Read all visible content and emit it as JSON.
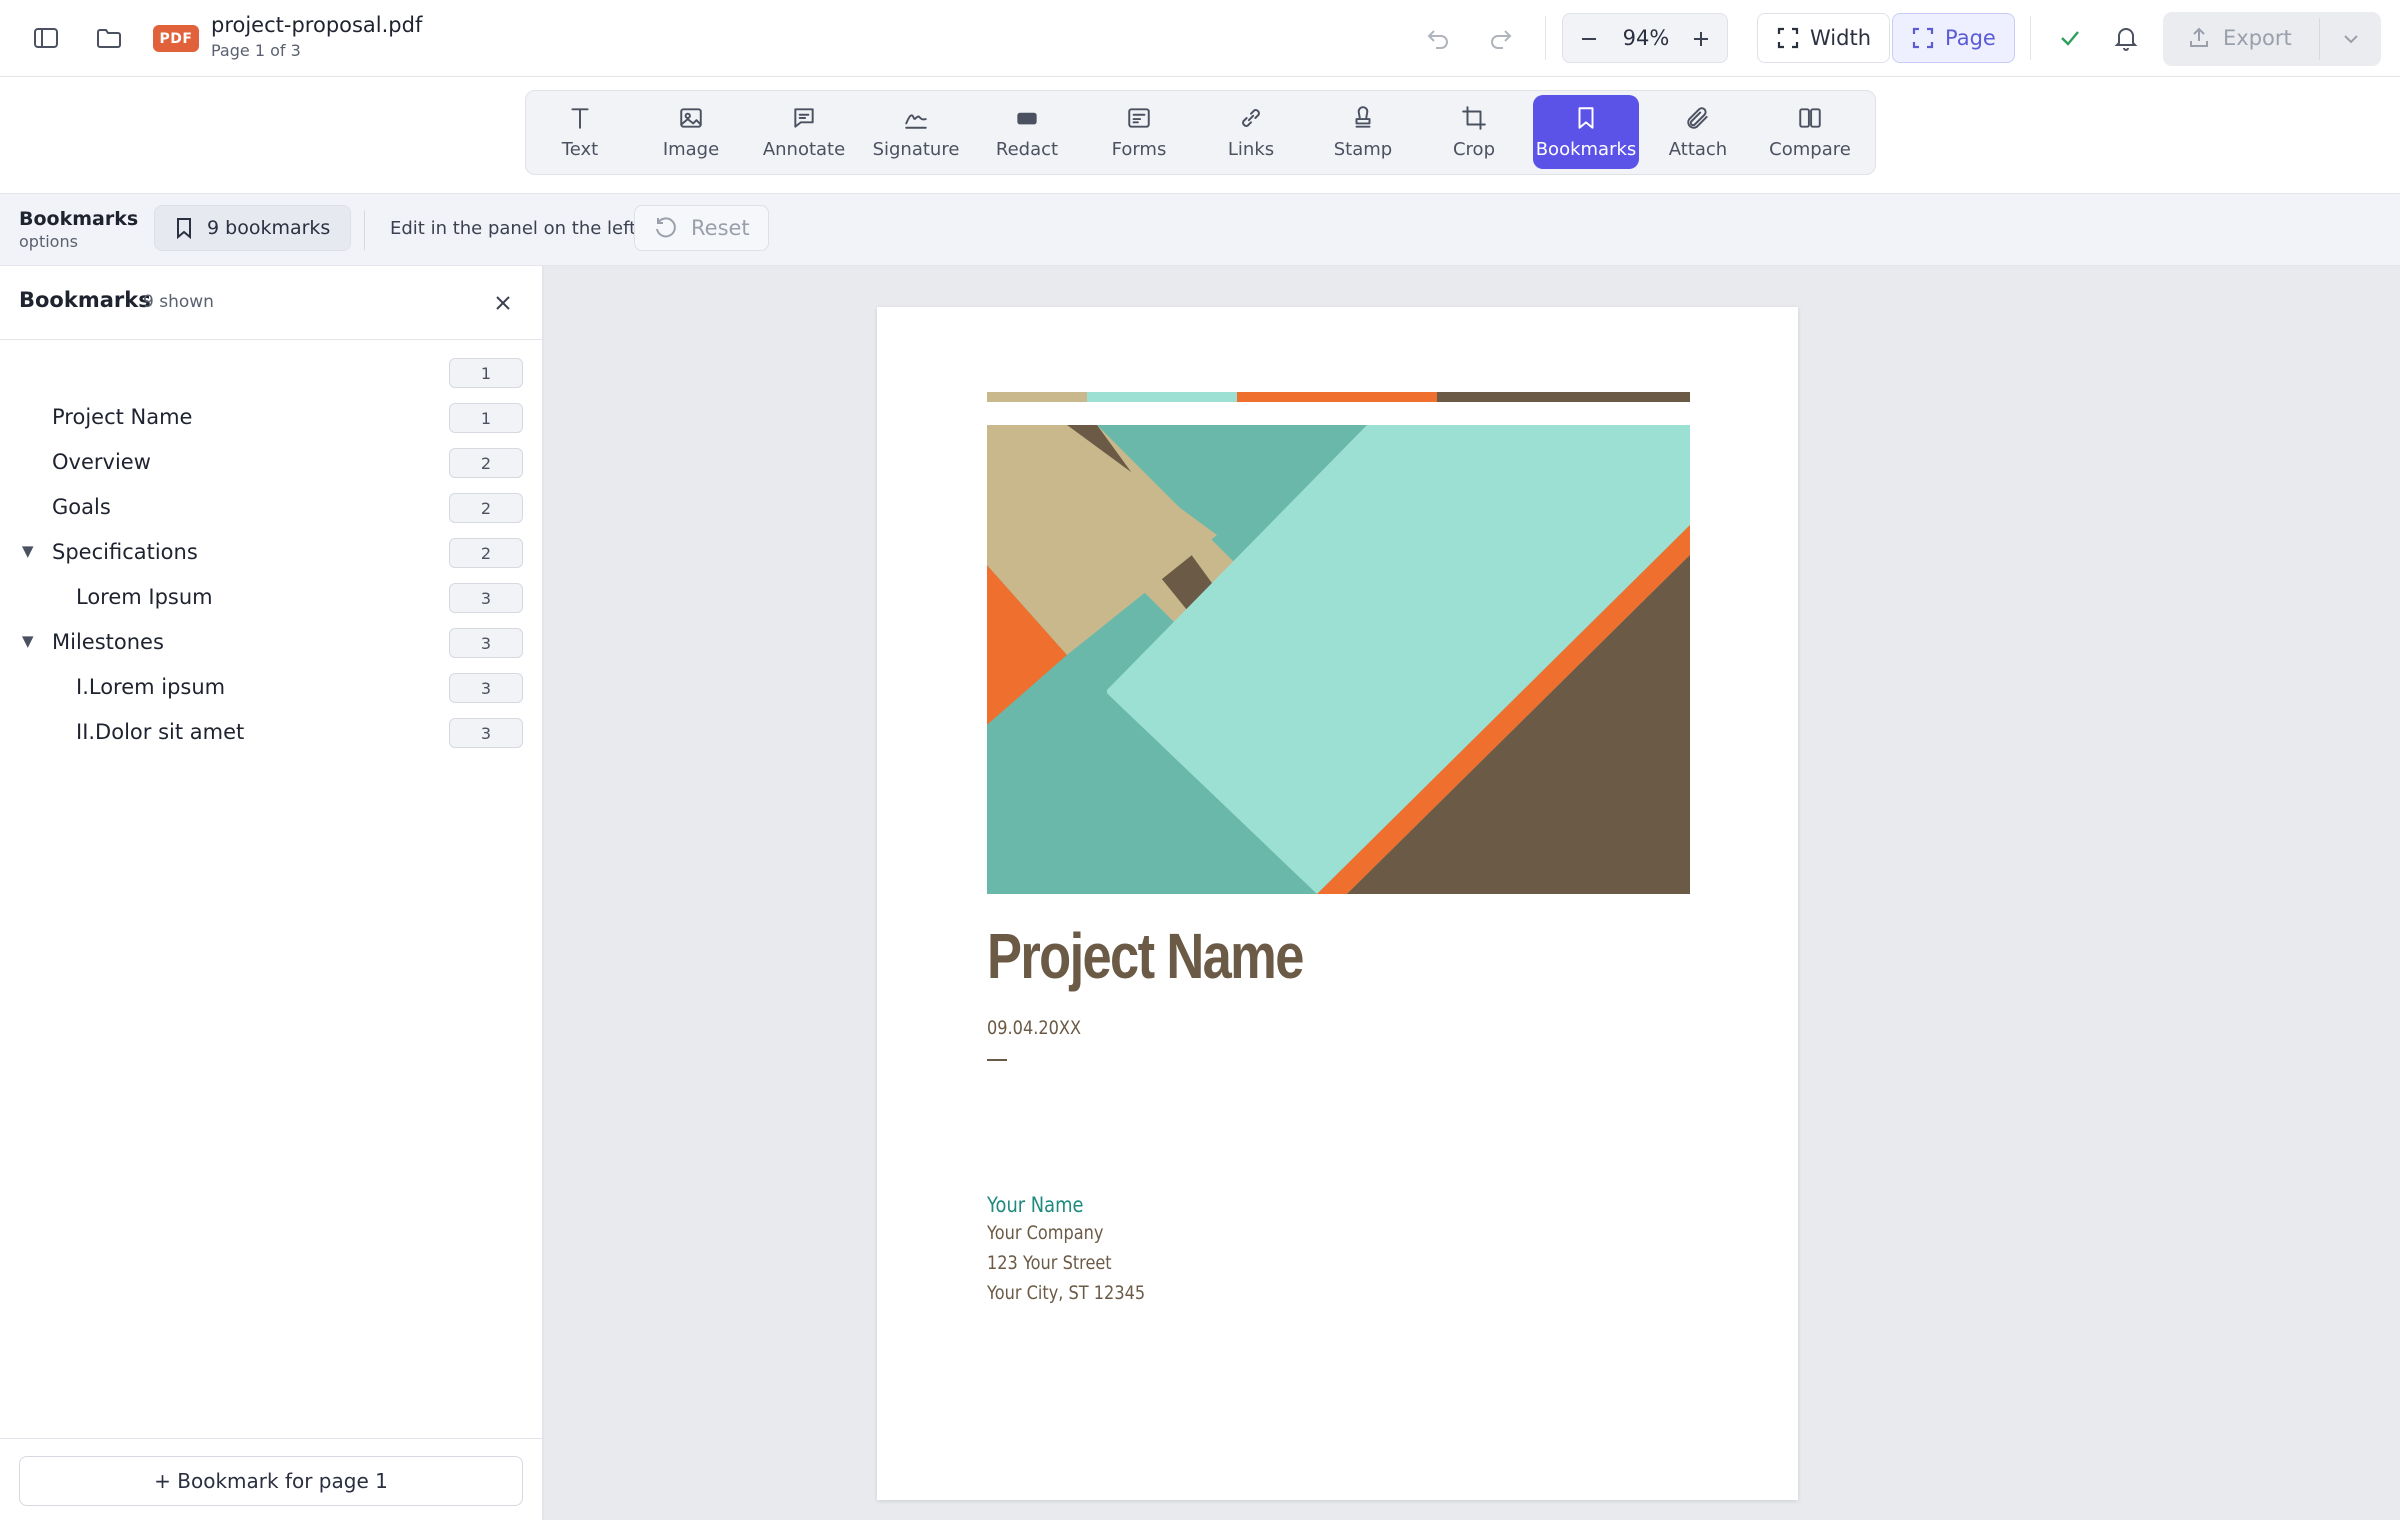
{
  "header": {
    "file_badge": "PDF",
    "file_name": "project-proposal.pdf",
    "page_info": "Page 1 of 3",
    "zoom": "94%",
    "fit_width_label": "Width",
    "fit_page_label": "Page",
    "export_label": "Export"
  },
  "toolbar": {
    "active": "Bookmarks",
    "tools": [
      {
        "label": "Text",
        "icon": "text-icon"
      },
      {
        "label": "Image",
        "icon": "image-icon"
      },
      {
        "label": "Annotate",
        "icon": "annotate-icon"
      },
      {
        "label": "Signature",
        "icon": "signature-icon"
      },
      {
        "label": "Redact",
        "icon": "redact-icon"
      },
      {
        "label": "Forms",
        "icon": "forms-icon"
      },
      {
        "label": "Links",
        "icon": "link-icon"
      },
      {
        "label": "Stamp",
        "icon": "stamp-icon"
      },
      {
        "label": "Crop",
        "icon": "crop-icon"
      },
      {
        "label": "Bookmarks",
        "icon": "bookmark-icon"
      },
      {
        "label": "Attach",
        "icon": "paperclip-icon"
      },
      {
        "label": "Compare",
        "icon": "compare-icon"
      }
    ]
  },
  "options": {
    "title": "Bookmarks",
    "subtitle": "options",
    "count_label": "9 bookmarks",
    "hint": "Edit in the panel on the left",
    "reset_label": "Reset"
  },
  "sidebar": {
    "title": "Bookmarks",
    "count": "9 shown",
    "bookmarks": [
      {
        "label": "",
        "page": "1",
        "level": 0,
        "expandable": false
      },
      {
        "label": "Project Name",
        "page": "1",
        "level": 0,
        "expandable": false
      },
      {
        "label": "Overview",
        "page": "2",
        "level": 0,
        "expandable": false
      },
      {
        "label": "Goals",
        "page": "2",
        "level": 0,
        "expandable": false
      },
      {
        "label": "Specifications",
        "page": "2",
        "level": 0,
        "expandable": true
      },
      {
        "label": "Lorem Ipsum",
        "page": "3",
        "level": 1,
        "expandable": false
      },
      {
        "label": "Milestones",
        "page": "3",
        "level": 0,
        "expandable": true
      },
      {
        "label": "I.Lorem ipsum",
        "page": "3",
        "level": 1,
        "expandable": false
      },
      {
        "label": "II.Dolor sit amet",
        "page": "3",
        "level": 1,
        "expandable": false
      }
    ],
    "add_label": "+ Bookmark for page 1"
  },
  "document": {
    "title": "Project Name",
    "date": "09.04.20XX",
    "author_name": "Your Name",
    "company": "Your Company",
    "street": "123 Your Street",
    "city": "Your City, ST 12345",
    "stripe_colors": [
      "#c9b88c",
      "#9ce0d4",
      "#ef6f2e",
      "#6b5a45"
    ]
  },
  "colors": {
    "accent": "#5b52e8",
    "pdf_badge": "#e0613a",
    "success": "#2f9e5a"
  }
}
